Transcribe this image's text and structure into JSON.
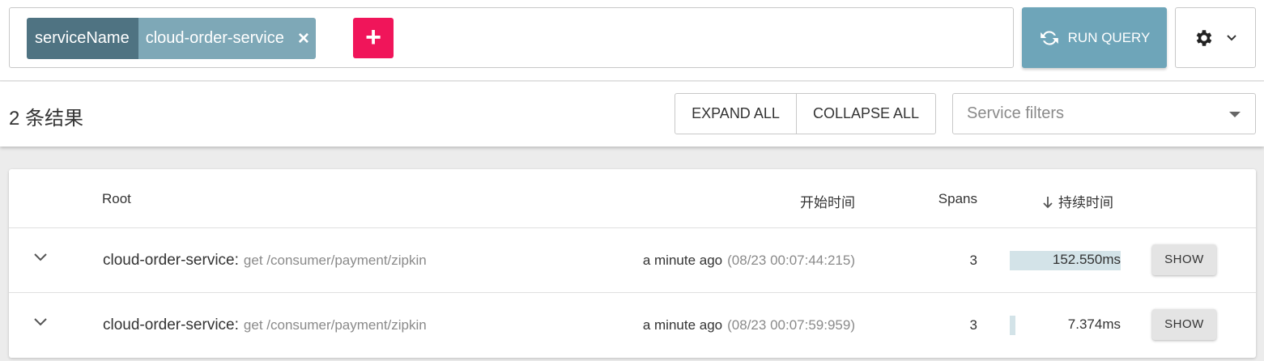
{
  "search": {
    "chip_key": "serviceName",
    "chip_value": "cloud-order-service",
    "chip_remove": "×",
    "add_label": "+"
  },
  "toolbar": {
    "run_query_label": "RUN QUERY",
    "icons": [
      "refresh-icon",
      "gear-icon",
      "chevron-down-icon"
    ]
  },
  "results": {
    "count_label": "2 条结果",
    "expand_all_label": "EXPAND ALL",
    "collapse_all_label": "COLLAPSE ALL",
    "service_filter_placeholder": "Service filters"
  },
  "table": {
    "columns": {
      "root": "Root",
      "start_time": "开始时间",
      "spans": "Spans",
      "duration": "持续时间"
    },
    "sort_icon": "arrow-down-icon",
    "rows": [
      {
        "service": "cloud-order-service:",
        "path": "get /consumer/payment/zipkin",
        "relative_time": "a minute ago",
        "absolute_time": "(08/23 00:07:44:215)",
        "spans": "3",
        "duration": "152.550ms",
        "duration_fraction": 1.0,
        "action": "SHOW"
      },
      {
        "service": "cloud-order-service:",
        "path": "get /consumer/payment/zipkin",
        "relative_time": "a minute ago",
        "absolute_time": "(08/23 00:07:59:959)",
        "spans": "3",
        "duration": "7.374ms",
        "duration_fraction": 0.048,
        "action": "SHOW"
      }
    ]
  },
  "colors": {
    "chip_key_bg": "#4f7382",
    "chip_value_bg": "#7ea8b7",
    "add_button": "#f0155a",
    "run_query_bg": "#6ea5b9",
    "duration_bar": "#d3e3e8"
  }
}
